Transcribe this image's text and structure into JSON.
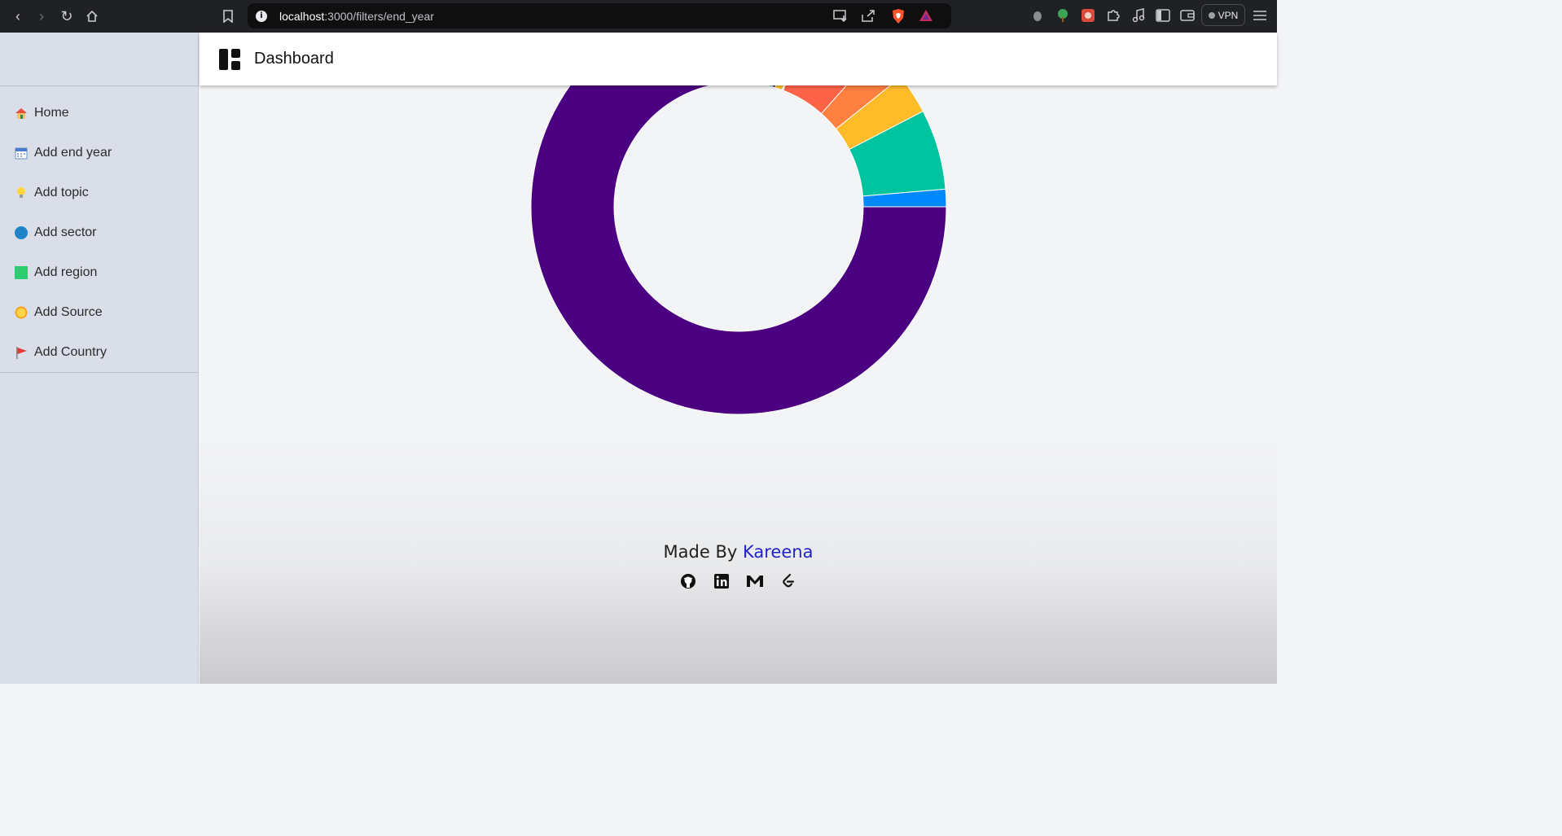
{
  "browser": {
    "url_host": "localhost",
    "url_path": ":3000/filters/end_year",
    "vpn_label": "VPN"
  },
  "header": {
    "title": "Dashboard"
  },
  "sidebar": {
    "items": [
      {
        "label": "Home",
        "icon": "house-icon"
      },
      {
        "label": "Add end year",
        "icon": "calendar-icon"
      },
      {
        "label": "Add topic",
        "icon": "lightbulb-icon"
      },
      {
        "label": "Add sector",
        "icon": "blue-circle-icon"
      },
      {
        "label": "Add region",
        "icon": "green-square-icon"
      },
      {
        "label": "Add Source",
        "icon": "sun-icon"
      },
      {
        "label": "Add Country",
        "icon": "flag-icon"
      }
    ]
  },
  "chart_data": {
    "type": "pie",
    "title": "",
    "slices": [
      {
        "value": 75.0,
        "color": "#4b0082"
      },
      {
        "value": 0.2,
        "color": "#7a5a4a"
      },
      {
        "value": 0.3,
        "color": "#b06080"
      },
      {
        "value": 0.6,
        "color": "#1a8f80"
      },
      {
        "value": 0.4,
        "color": "#3b2a8a"
      },
      {
        "value": 0.9,
        "color": "#ffc21a"
      },
      {
        "value": 0.15,
        "color": "#ffffff"
      },
      {
        "value": 5.5,
        "color": "#ff6347"
      },
      {
        "value": 2.6,
        "color": "#ff8040"
      },
      {
        "value": 3.0,
        "color": "#ffbb28"
      },
      {
        "value": 6.0,
        "color": "#00c49f"
      },
      {
        "value": 1.3,
        "color": "#0088fe"
      }
    ]
  },
  "footer": {
    "made_by": "Made By ",
    "author": "Kareena",
    "socials": [
      "github-icon",
      "linkedin-icon",
      "gmail-icon",
      "leetcode-icon"
    ]
  }
}
